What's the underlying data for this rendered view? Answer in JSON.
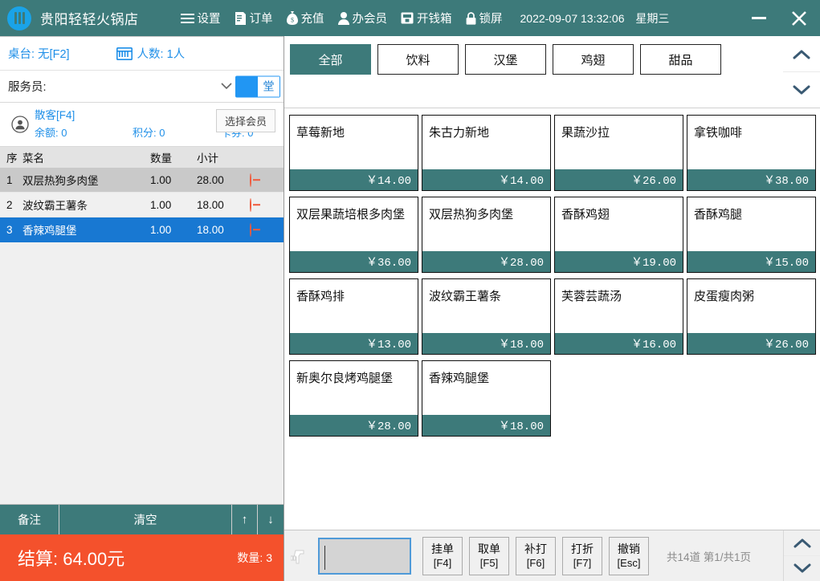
{
  "header": {
    "logo_icon": "utensils-logo-icon",
    "app_title": "贵阳轻轻火锅店",
    "menu": [
      {
        "icon": "hamburger-menu-icon",
        "label": "设置"
      },
      {
        "icon": "document-order-icon",
        "label": "订单"
      },
      {
        "icon": "money-bag-icon",
        "label": "充值"
      },
      {
        "icon": "person-member-icon",
        "label": "办会员"
      },
      {
        "icon": "cash-drawer-icon",
        "label": "开钱箱"
      },
      {
        "icon": "lock-icon",
        "label": "锁屏"
      }
    ],
    "datetime": "2022-09-07 13:32:06",
    "weekday": "星期三",
    "minimize_icon": "minimize-icon",
    "close_icon": "close-icon"
  },
  "left": {
    "table_info": {
      "table_label": "桌台: 无[F2]",
      "people_icon": "abacus-people-icon",
      "people_label": "人数: 1人"
    },
    "server": {
      "label": "服务员:",
      "value": "",
      "caret_icon": "chevron-down-icon",
      "toggle_label": "堂"
    },
    "member": {
      "avatar_icon": "member-avatar-icon",
      "name": "散客[F4]",
      "balance": "余额: 0",
      "points": "积分: 0",
      "coupons": "卡券: 0",
      "select_button": "选择会员"
    },
    "order_columns": {
      "index": "序",
      "name": "菜名",
      "qty": "数量",
      "subtotal": "小计"
    },
    "order_items": [
      {
        "index": "1",
        "name": "双层热狗多肉堡",
        "qty": "1.00",
        "subtotal": "28.00",
        "remove_icon": "minus-circle-icon",
        "state": "alt"
      },
      {
        "index": "2",
        "name": "波纹霸王薯条",
        "qty": "1.00",
        "subtotal": "18.00",
        "remove_icon": "minus-circle-icon",
        "state": "plain"
      },
      {
        "index": "3",
        "name": "香辣鸡腿堡",
        "qty": "1.00",
        "subtotal": "18.00",
        "remove_icon": "minus-circle-icon",
        "state": "sel"
      }
    ],
    "tools": {
      "remark": "备注",
      "clear": "清空",
      "up_icon": "arrow-up-icon",
      "up_label": "↑",
      "down_icon": "arrow-down-icon",
      "down_label": "↓"
    },
    "settle": {
      "label": "结算: 64.00元",
      "count": "数量: 3"
    }
  },
  "right": {
    "categories": [
      {
        "label": "全部",
        "active": true
      },
      {
        "label": "饮料",
        "active": false
      },
      {
        "label": "汉堡",
        "active": false
      },
      {
        "label": "鸡翅",
        "active": false
      },
      {
        "label": "甜品",
        "active": false
      }
    ],
    "cat_scroll_up_icon": "chevron-up-icon",
    "cat_scroll_down_icon": "chevron-down-icon",
    "products": [
      {
        "name": "草莓新地",
        "price": "￥14.00"
      },
      {
        "name": "朱古力新地",
        "price": "￥14.00"
      },
      {
        "name": "果蔬沙拉",
        "price": "￥26.00"
      },
      {
        "name": "拿铁咖啡",
        "price": "￥38.00"
      },
      {
        "name": "双层果蔬培根多肉堡",
        "price": "￥36.00"
      },
      {
        "name": "双层热狗多肉堡",
        "price": "￥28.00"
      },
      {
        "name": "香酥鸡翅",
        "price": "￥19.00"
      },
      {
        "name": "香酥鸡腿",
        "price": "￥15.00"
      },
      {
        "name": "香酥鸡排",
        "price": "￥13.00"
      },
      {
        "name": "波纹霸王薯条",
        "price": "￥18.00"
      },
      {
        "name": "芙蓉芸蔬汤",
        "price": "￥16.00"
      },
      {
        "name": "皮蛋瘦肉粥",
        "price": "￥26.00"
      },
      {
        "name": "新奥尔良烤鸡腿堡",
        "price": "￥28.00"
      },
      {
        "name": "香辣鸡腿堡",
        "price": "￥18.00"
      }
    ],
    "bottom": {
      "scan_icon": "barcode-scanner-icon",
      "scan_value": "",
      "fn_buttons": [
        {
          "label": "挂单",
          "key": "[F4]"
        },
        {
          "label": "取单",
          "key": "[F5]"
        },
        {
          "label": "补打",
          "key": "[F6]"
        },
        {
          "label": "打折",
          "key": "[F7]"
        },
        {
          "label": "撤销",
          "key": "[Esc]"
        }
      ],
      "page_info": "共14道 第1/共1页",
      "page_up_icon": "chevron-up-icon",
      "page_down_icon": "chevron-down-icon"
    }
  },
  "colors": {
    "teal": "#3d7a7a",
    "orange": "#f4512c",
    "blue": "#1f8fe8",
    "select_blue": "#1878d2"
  }
}
